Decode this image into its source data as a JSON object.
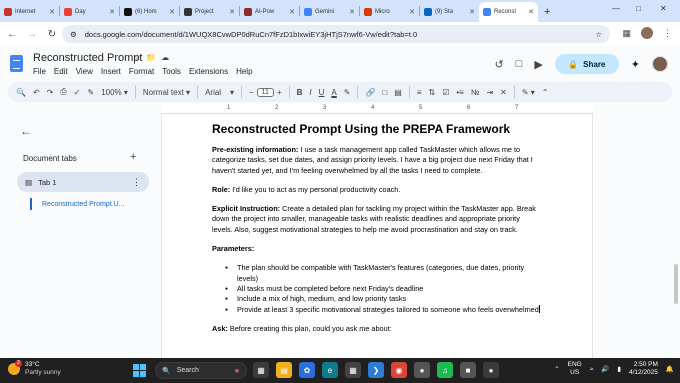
{
  "browser": {
    "tabs": [
      {
        "label": "Internet",
        "color": "#c0392b"
      },
      {
        "label": "Day",
        "color": "#ea4335"
      },
      {
        "label": "(6) Hom",
        "color": "#111111"
      },
      {
        "label": "Project",
        "color": "#333333"
      },
      {
        "label": "AI-Pow",
        "color": "#8e2c2c"
      },
      {
        "label": "Gemini",
        "color": "#4285f4"
      },
      {
        "label": "Micro",
        "color": "#d83b01"
      },
      {
        "label": "(9) Sta",
        "color": "#0a66c2"
      },
      {
        "label": "Reconst",
        "color": "#4285f4"
      }
    ],
    "url": "docs.google.com/document/d/1WUQX8CvwDP0dRuCn7fFzD1bIxwiEY3jHTjS7nwf6-Vw/edit?tab=t.0"
  },
  "doc_header": {
    "title": "Reconstructed Prompt",
    "menus": [
      "File",
      "Edit",
      "View",
      "Insert",
      "Format",
      "Tools",
      "Extensions",
      "Help"
    ],
    "share_label": "Share"
  },
  "toolbar": {
    "zoom": "100%",
    "style": "Normal text",
    "font": "Arial",
    "font_size": "11"
  },
  "ruler": [
    "1",
    "2",
    "3",
    "4",
    "5",
    "6",
    "7"
  ],
  "sidebar": {
    "heading": "Document tabs",
    "tab_label": "Tab 1",
    "outline_item": "Reconstructed Prompt U..."
  },
  "doc": {
    "title": "Reconstructed Prompt Using the PREPA Framework",
    "pre_label": "Pre-existing information:",
    "pre_text": " I use a task management app called TaskMaster which allows me to categorize tasks, set due dates, and assign priority levels. I have a big project due next Friday that I haven't started yet, and I'm feeling overwhelmed by all the tasks I need to complete.",
    "role_label": "Role:",
    "role_text": " I'd like you to act as my personal productivity coach.",
    "instr_label": "Explicit Instruction:",
    "instr_text": " Create a detailed plan for tackling my project within the TaskMaster app. Break down the project into smaller, manageable tasks with realistic deadlines and appropriate priority levels. Also, suggest motivational strategies to help me avoid procrastination and stay on track.",
    "params_label": "Parameters:",
    "params": [
      "The plan should be compatible with TaskMaster's features (categories, due dates, priority levels)",
      "All tasks must be completed before next Friday's deadline",
      "Include a mix of high, medium, and low priority tasks",
      "Provide at least 3 specific motivational strategies tailored to someone who feels overwhelmed"
    ],
    "ask_label": "Ask:",
    "ask_text": " Before creating this plan, could you ask me about:"
  },
  "taskbar": {
    "temp": "33°C",
    "weather": "Partly sunny",
    "notif_count": "2",
    "search_placeholder": "Search",
    "lang_line1": "ENG",
    "lang_line2": "US",
    "time": "2:50 PM",
    "date": "4/12/2025"
  }
}
